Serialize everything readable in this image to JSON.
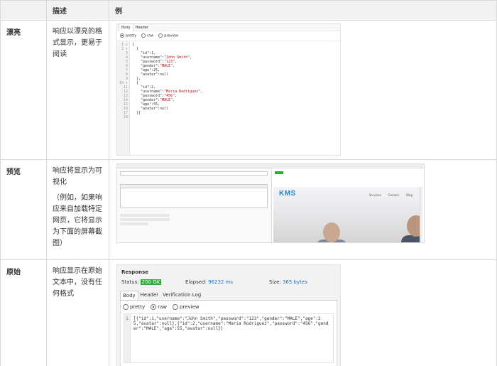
{
  "headers": {
    "col1": "",
    "col2": "描述",
    "col3": "例"
  },
  "rows": [
    {
      "name": "漂亮",
      "desc": [
        "响应以漂亮的格式显示，更易于阅读"
      ]
    },
    {
      "name": "预览",
      "desc": [
        "响应将显示为可视化",
        "（例如，如果响应来自加载特定网页，它将显示为下面的屏幕截图）"
      ]
    },
    {
      "name": "原始",
      "desc": [
        "响应显示在原始文本中，没有任何格式"
      ]
    }
  ],
  "pretty": {
    "tabs": [
      "Body",
      "Header"
    ],
    "options": [
      "pretty",
      "raw",
      "preview"
    ],
    "line_numbers": [
      "1 ▾",
      "2 ▾",
      "3",
      "4",
      "5",
      "6",
      "7",
      "8",
      "9",
      "10 ▾",
      "11",
      "12",
      "13",
      "14",
      "15",
      "16",
      "17",
      "18"
    ],
    "lines": [
      "[",
      "  {",
      "    \"id\":1,",
      "    \"username\":\"John Smith\",",
      "    \"password\":\"123\",",
      "    \"gender\":\"MALE\",",
      "    \"age\":25,",
      "    \"avatar\":null",
      "  },",
      "  {",
      "    \"id\":2,",
      "    \"username\":\"Maria Rodriguez\",",
      "    \"password\":\"456\",",
      "    \"gender\":\"MALE\",",
      "    \"age\":55,",
      "    \"avatar\":null",
      "  }]",
      ""
    ]
  },
  "preview": {
    "logo": "KMS",
    "logo_sub": "",
    "nav": [
      "Services",
      "Careers",
      "Blog"
    ]
  },
  "raw": {
    "title": "Response",
    "status_label": "Status:",
    "status_value": "200 OK",
    "elapsed_label": "Elapsed:",
    "elapsed_value": "96232 ms",
    "size_label": "Size:",
    "size_value": "365 bytes",
    "tabs": [
      "Body",
      "Header",
      "Verification Log"
    ],
    "options": [
      "pretty",
      "raw",
      "preview"
    ],
    "line_number": "1",
    "text": "[{\"id\":1,\"username\":\"John Smith\",\"password\":\"123\",\"gender\":\"MALE\",\"age\":25,\"avatar\":null},{\"id\":2,\"username\":\"Maria Rodriguez\",\"password\":\"456\",\"gender\":\"MALE\",\"age\":55,\"avatar\":null}]"
  },
  "colors": {
    "status_green": "#2eaa3c",
    "link_blue": "#1a6fcf",
    "kms_blue": "#1b7fc8"
  }
}
